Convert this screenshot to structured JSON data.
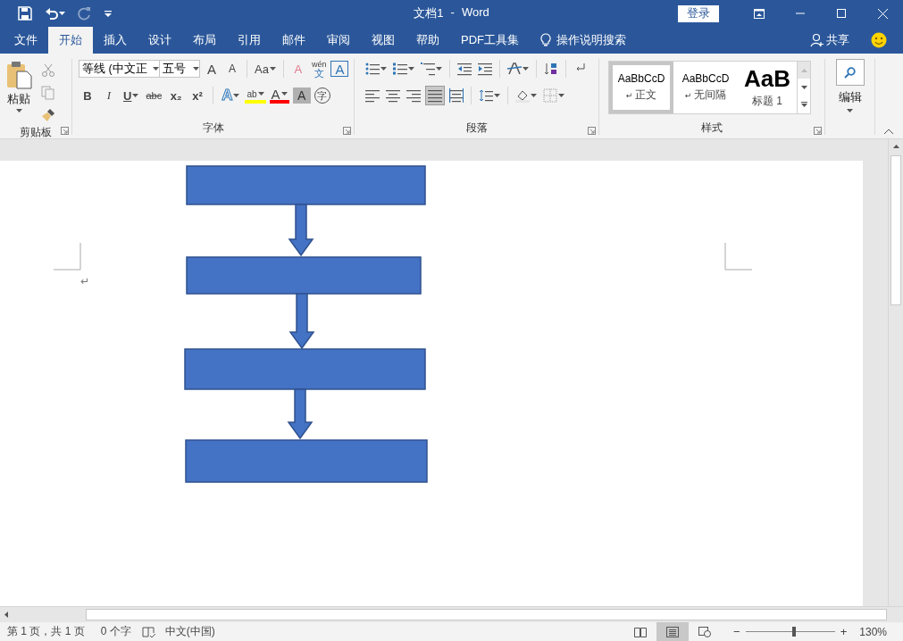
{
  "title_bar": {
    "redo_disabled": true,
    "document": "文档1",
    "separator": "-",
    "app": "Word",
    "sign_in": "登录"
  },
  "tabs": [
    {
      "label": "文件",
      "selected": false
    },
    {
      "label": "开始",
      "selected": true
    },
    {
      "label": "插入",
      "selected": false
    },
    {
      "label": "设计",
      "selected": false
    },
    {
      "label": "布局",
      "selected": false
    },
    {
      "label": "引用",
      "selected": false
    },
    {
      "label": "邮件",
      "selected": false
    },
    {
      "label": "审阅",
      "selected": false
    },
    {
      "label": "视图",
      "selected": false
    },
    {
      "label": "帮助",
      "selected": false
    },
    {
      "label": "PDF工具集",
      "selected": false
    }
  ],
  "tell_me": "操作说明搜索",
  "share": "共享",
  "ribbon": {
    "clipboard": {
      "paste": "粘贴",
      "label": "剪贴板"
    },
    "font": {
      "label": "字体",
      "font_name": "等线 (中文正",
      "font_size": "五号",
      "row1": [
        {
          "kind": "grow",
          "text": "A"
        },
        {
          "kind": "shrink",
          "text": "A"
        },
        {
          "kind": "case",
          "text": "Aa"
        },
        {
          "kind": "clear",
          "text": "A"
        },
        {
          "kind": "pinyin",
          "text": "wén",
          "sub": "文"
        },
        {
          "kind": "border",
          "text": "A"
        }
      ],
      "row2": [
        {
          "kind": "plain",
          "text": "B"
        },
        {
          "kind": "italic",
          "text": "I"
        },
        {
          "kind": "underline",
          "text": "U"
        },
        {
          "kind": "strike",
          "text": "abc"
        },
        {
          "kind": "plain",
          "text": "x₂"
        },
        {
          "kind": "plain",
          "text": "x²"
        },
        {
          "kind": "effects",
          "text": "A"
        },
        {
          "kind": "highlight",
          "text": "ab"
        },
        {
          "kind": "color",
          "text": "A"
        },
        {
          "kind": "shade",
          "text": "A"
        },
        {
          "kind": "circle",
          "text": "字"
        }
      ]
    },
    "paragraph": {
      "label": "段落"
    },
    "styles": {
      "label": "样式",
      "items": [
        {
          "kind": "body",
          "preview": "AaBbCcD",
          "mark": "↵",
          "name": "正文",
          "selected": true
        },
        {
          "kind": "body",
          "preview": "AaBbCcD",
          "mark": "↵",
          "name": "无间隔",
          "selected": false
        },
        {
          "kind": "heading",
          "preview": "AaB",
          "name": "标题 1",
          "selected": false
        }
      ]
    },
    "editing": {
      "label": "编辑"
    }
  },
  "page": {
    "paragraph_mark": "↵",
    "flowchart": [
      {
        "kind": "box"
      },
      {
        "kind": "arrow"
      },
      {
        "kind": "box"
      },
      {
        "kind": "arrow"
      },
      {
        "kind": "box"
      },
      {
        "kind": "arrow"
      },
      {
        "kind": "box"
      }
    ]
  },
  "status_bar": {
    "page": "第 1 页，共 1 页",
    "words": "0 个字",
    "language": "中文(中国)",
    "views": [
      {
        "selected": false
      },
      {
        "selected": true
      },
      {
        "selected": false
      }
    ],
    "zoom_minus": "−",
    "zoom_slider": {
      "level": 0.54
    },
    "zoom_plus": "+",
    "zoom": "130%"
  }
}
